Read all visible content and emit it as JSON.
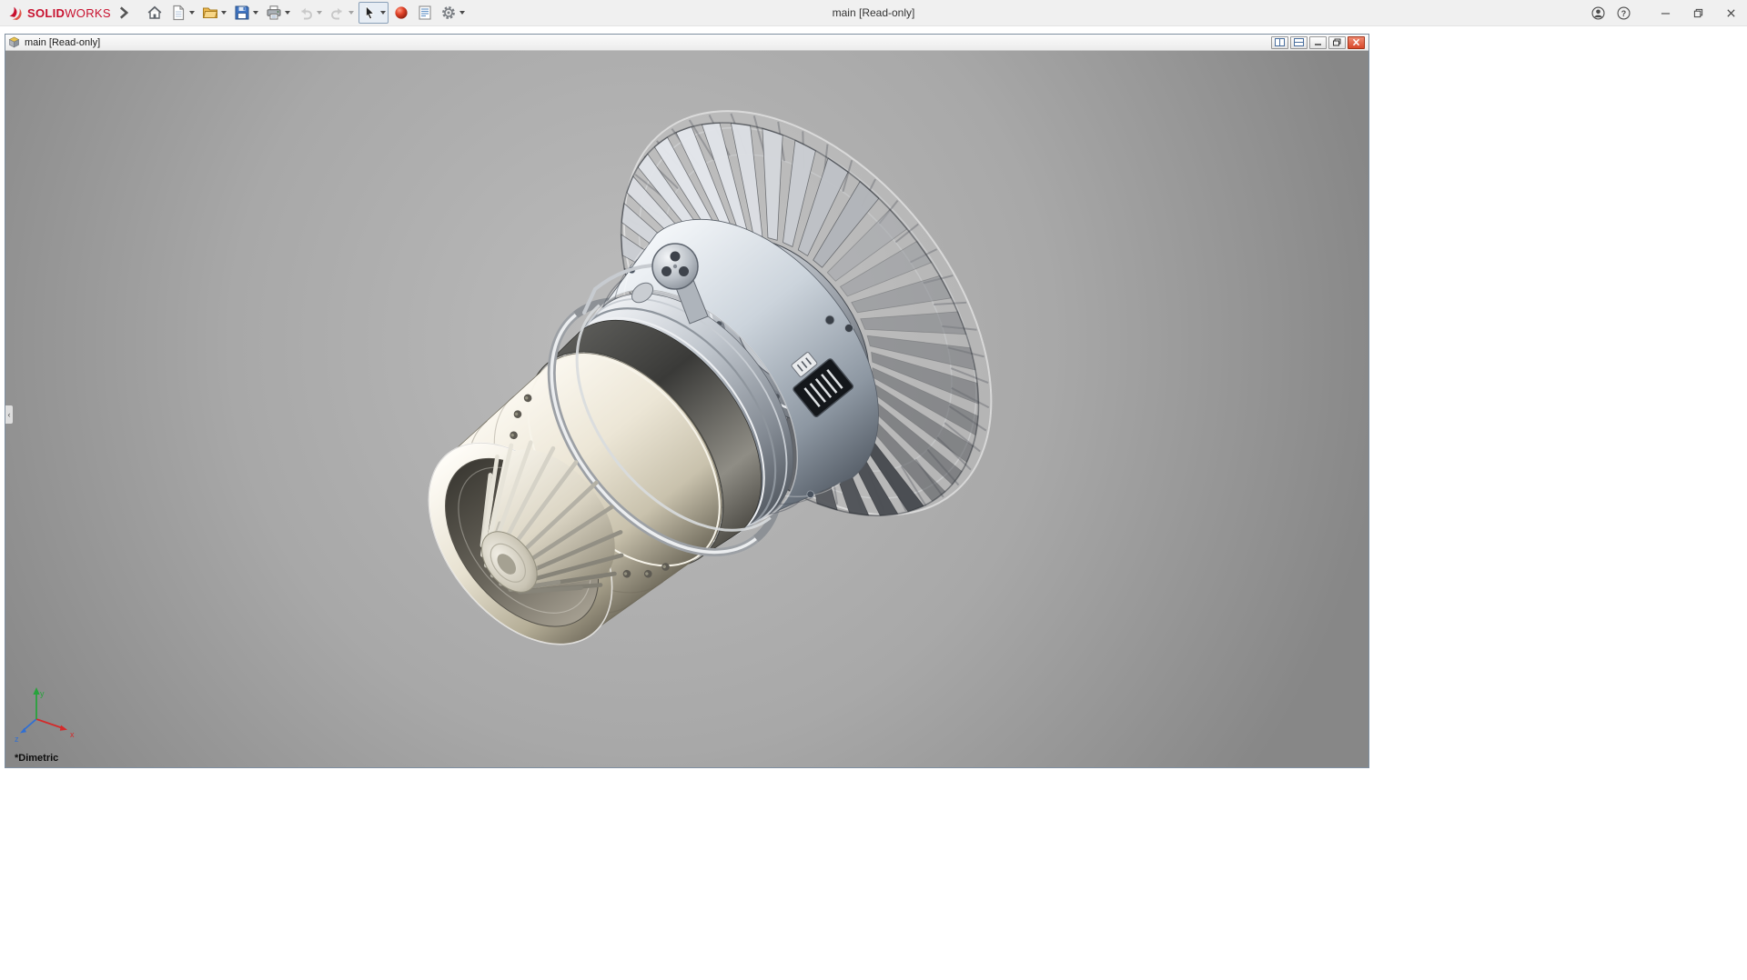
{
  "titlebar": {
    "brand": {
      "solid": "SOLID",
      "works": "WORKS"
    },
    "document_title": "main [Read-only]",
    "help_glyph": "?"
  },
  "child_window": {
    "title": "main [Read-only]"
  },
  "viewport": {
    "orientation": "*Dimetric",
    "triad": {
      "x": "x",
      "y": "y",
      "z": "z"
    }
  },
  "colors": {
    "brand_red": "#c8102e",
    "close_button_red": "#d8472a",
    "viewport_top": "#bcbcbc",
    "viewport_bottom": "#878787"
  }
}
